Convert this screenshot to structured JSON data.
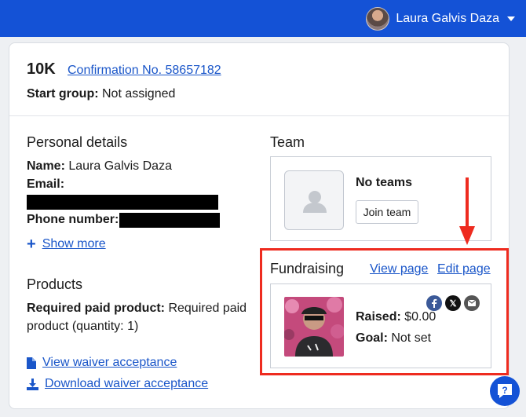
{
  "header": {
    "user_name": "Laura Galvis Daza"
  },
  "registration": {
    "race": "10K",
    "confirmation": "Confirmation No. 58657182",
    "start_group_label": "Start group:",
    "start_group_value": "Not assigned"
  },
  "personal": {
    "title": "Personal details",
    "name_label": "Name:",
    "name_value": "Laura Galvis Daza",
    "email_label": "Email:",
    "phone_label": "Phone number:",
    "show_more": "Show more"
  },
  "products": {
    "title": "Products",
    "label": "Required paid product:",
    "value": "Required paid product (quantity: 1)"
  },
  "waiver": {
    "view": "View waiver acceptance",
    "download": "Download waiver acceptance"
  },
  "team": {
    "title": "Team",
    "no_teams": "No teams",
    "join": "Join team"
  },
  "fundraising": {
    "title": "Fundraising",
    "view_page": "View page",
    "edit_page": "Edit page",
    "raised_label": "Raised:",
    "raised_value": "$0.00",
    "goal_label": "Goal:",
    "goal_value": "Not set",
    "social_x": "𝕏"
  },
  "colors": {
    "brand": "#1452d6",
    "link": "#1a56c9",
    "highlight": "#ee2b1f",
    "facebook": "#3b5998"
  },
  "icons": [
    "caret-down-icon",
    "plus-icon",
    "document-icon",
    "download-icon",
    "user-placeholder-icon",
    "facebook-icon",
    "x-icon",
    "email-icon",
    "help-icon",
    "arrow-down-icon"
  ]
}
